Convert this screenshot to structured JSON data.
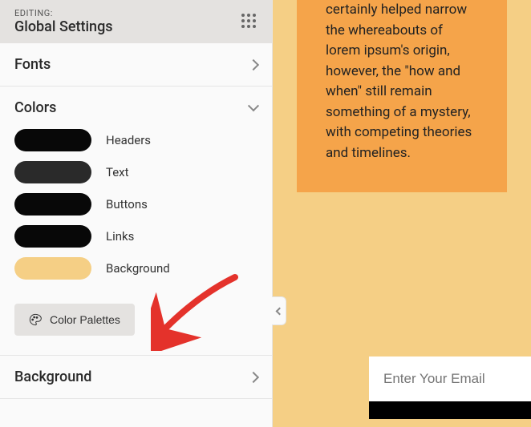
{
  "header": {
    "editing_label": "EDITING:",
    "title": "Global Settings"
  },
  "sections": {
    "fonts": {
      "title": "Fonts"
    },
    "colors": {
      "title": "Colors",
      "swatches": [
        {
          "label": "Headers",
          "color": "#080808"
        },
        {
          "label": "Text",
          "color": "#2a2a2a"
        },
        {
          "label": "Buttons",
          "color": "#080808"
        },
        {
          "label": "Links",
          "color": "#080808"
        },
        {
          "label": "Background",
          "color": "#f5cf85"
        }
      ],
      "palettes_button": "Color Palettes"
    },
    "background": {
      "title": "Background"
    }
  },
  "preview": {
    "card_text": "certainly helped narrow the whereabouts of lorem ipsum's origin, however, the \"how and when\" still remain something of a mystery, with competing theories and timelines.",
    "email_placeholder": "Enter Your Email"
  }
}
